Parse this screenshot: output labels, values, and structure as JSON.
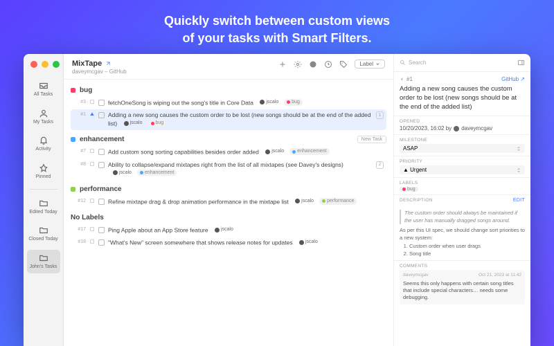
{
  "hero_line1": "Quickly switch between custom views",
  "hero_line2": "of your tasks with Smart Filters.",
  "sidebar": {
    "items": [
      {
        "label": "All Tasks"
      },
      {
        "label": "My Tasks"
      },
      {
        "label": "Activity"
      },
      {
        "label": "Pinned"
      },
      {
        "label": "Edited Today"
      },
      {
        "label": "Closed Today"
      },
      {
        "label": "John's Tasks"
      }
    ]
  },
  "title": {
    "name": "MixTape",
    "sub": "daveymcgav – GitHub",
    "label_btn": "Label"
  },
  "sections": [
    {
      "name": "bug",
      "color": "#ff3b6b",
      "tasks": [
        {
          "num": "#3",
          "icon": "sq",
          "text": "fetchOneSong is wiping out the song's title in Core Data",
          "user": "jscalo",
          "tag": "bug",
          "tagc": "#ff3b6b"
        },
        {
          "num": "#1",
          "icon": "tri",
          "sel": true,
          "text": "Adding a new song causes the custom order to be lost (new songs should be at the end of the added list)",
          "user": "jscalo",
          "tag": "bug",
          "tagc": "#ff3b6b",
          "count": "1"
        }
      ]
    },
    {
      "name": "enhancement",
      "color": "#4aa8ff",
      "new": "New Task",
      "tasks": [
        {
          "num": "#7",
          "icon": "sq",
          "text": "Add custom song sorting capabilities besides order added",
          "user": "jscalo",
          "tag": "enhancement",
          "tagc": "#4aa8ff"
        },
        {
          "num": "#8",
          "icon": "sq",
          "text": "Ability to collapse/expand mixtapes right from the list of all mixtapes (see Davey's designs)",
          "user": "jscalo",
          "tag": "enhancement",
          "tagc": "#4aa8ff",
          "count": "2"
        }
      ]
    },
    {
      "name": "performance",
      "color": "#8fd14f",
      "tasks": [
        {
          "num": "#12",
          "icon": "sq",
          "text": "Refine mixtape drag & drop animation performance in the mixtape list",
          "user": "jscalo",
          "tag": "performance",
          "tagc": "#8fd14f"
        }
      ]
    },
    {
      "name": "No Labels",
      "color": "",
      "tasks": [
        {
          "num": "#17",
          "icon": "sq",
          "text": "Ping Apple about an App Store feature",
          "user": "jscalo"
        },
        {
          "num": "#18",
          "icon": "sq",
          "text": "\"What's New\" screen somewhere that shows release notes for updates",
          "user": "jscalo"
        }
      ]
    }
  ],
  "detail": {
    "search_ph": "Search",
    "num": "#1",
    "source": "GitHub",
    "title": "Adding a new song causes the custom order to be lost (new songs should be at the end of the added list)",
    "opened_label": "OPENED",
    "opened": "10/20/2023, 16:02 by",
    "opened_user": "daveymcgav",
    "milestone_label": "MILESTONE",
    "milestone": "ASAP",
    "priority_label": "PRIORITY",
    "priority": "Urgent",
    "labels_label": "LABELS",
    "labels_tag": "bug",
    "labels_color": "#ff3b6b",
    "desc_label": "DESCRIPTION",
    "edit": "Edit",
    "desc_quote": "The custom order should always be maintained if the user has manually dragged songs around.",
    "desc_body": "As per this UI spec, we should change sort priorities to a new system:",
    "desc_list": [
      "Custom order when user drags",
      "Song title"
    ],
    "comments_label": "COMMENTS",
    "comment": {
      "user": "daveymcgav",
      "date": "Oct 21, 2023 at 11:42",
      "text": "Seems this only happens with certain song titles that include special characters… needs some debugging."
    }
  }
}
